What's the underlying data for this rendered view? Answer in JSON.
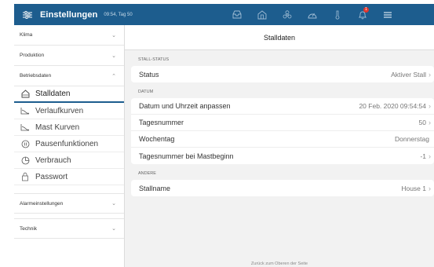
{
  "header": {
    "title": "Einstellungen",
    "time": "09:54, Tag 50",
    "notification_count": "1",
    "icons": [
      "inbox-icon",
      "house-icon",
      "fan-icon",
      "gauge-icon",
      "thermometer-icon",
      "bell-icon",
      "hamburger-menu-icon"
    ]
  },
  "sidebar": {
    "sections": [
      {
        "label": "Klima",
        "expanded": false
      },
      {
        "label": "Produktion",
        "expanded": false
      },
      {
        "label": "Betriebsdaten",
        "expanded": true
      }
    ],
    "items": [
      {
        "label": "Stalldaten",
        "icon": "barn-icon",
        "active": true
      },
      {
        "label": "Verlaufkurven",
        "icon": "curve-icon",
        "active": false
      },
      {
        "label": "Mast Kurven",
        "icon": "curve-icon",
        "active": false
      },
      {
        "label": "Pausenfunktionen",
        "icon": "pause-icon",
        "active": false
      },
      {
        "label": "Verbrauch",
        "icon": "consumption-icon",
        "active": false
      },
      {
        "label": "Passwort",
        "icon": "lock-icon",
        "active": false
      }
    ],
    "bottom_sections": [
      {
        "label": "Alarmeinstellungen",
        "expanded": false
      },
      {
        "label": "Technik",
        "expanded": false
      }
    ]
  },
  "main": {
    "title": "Stalldaten",
    "groups": [
      {
        "label": "STALL-STATUS",
        "rows": [
          {
            "label": "Status",
            "value": "Aktiver Stall",
            "has_chevron": true
          }
        ]
      },
      {
        "label": "DATUM",
        "rows": [
          {
            "label": "Datum und Uhrzeit anpassen",
            "value": "20 Feb. 2020 09:54:54",
            "has_chevron": true
          },
          {
            "label": "Tagesnummer",
            "value": "50",
            "has_chevron": true
          },
          {
            "label": "Wochentag",
            "value": "Donnerstag",
            "has_chevron": false
          },
          {
            "label": "Tagesnummer bei Mastbeginn",
            "value": "-1",
            "has_chevron": true
          }
        ]
      },
      {
        "label": "ANDERE",
        "rows": [
          {
            "label": "Stallname",
            "value": "House 1",
            "has_chevron": true
          }
        ]
      }
    ],
    "footer_link": "Zurück zum Oberen der Seite"
  },
  "colors": {
    "header_bg": "#1d5d8e",
    "badge": "#e1362d",
    "content_bg": "#f2f2f2"
  }
}
